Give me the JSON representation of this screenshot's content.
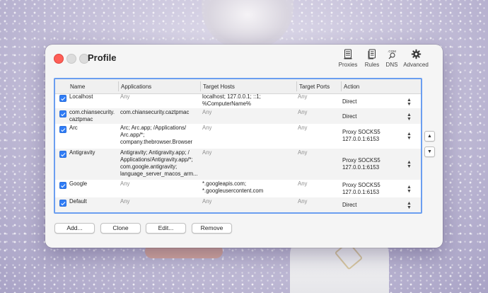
{
  "window": {
    "title": "Profile"
  },
  "toolbar": {
    "proxies": {
      "label": "Proxies",
      "icon": "server-icon"
    },
    "rules": {
      "label": "Rules",
      "icon": "document-list-icon"
    },
    "dns": {
      "label": "DNS",
      "icon": "dns-icon",
      "badge": ".COM"
    },
    "advanced": {
      "label": "Advanced",
      "icon": "gear-icon"
    }
  },
  "table": {
    "headers": {
      "name": "Name",
      "applications": "Applications",
      "target_hosts": "Target Hosts",
      "target_ports": "Target Ports",
      "action": "Action"
    },
    "rows": [
      {
        "enabled": true,
        "name": "Localhost",
        "applications": "Any",
        "target_hosts": "localhost; 127.0.0.1; ::1; %ComputerName%",
        "target_ports": "Any",
        "action": "Direct"
      },
      {
        "enabled": true,
        "name": "com.chiansecurity. caztpmac",
        "applications": "com.chiansecurity.caztpmac",
        "target_hosts": "Any",
        "target_ports": "Any",
        "action": "Direct"
      },
      {
        "enabled": true,
        "name": "Arc",
        "applications": "Arc; Arc.app; /Applications/ Arc.app/*; company.thebrowser.Browser",
        "target_hosts": "Any",
        "target_ports": "Any",
        "action": "Proxy SOCKS5 127.0.0.1:6153"
      },
      {
        "enabled": true,
        "name": "Antigravity",
        "applications": "Antigravity; Antigravity.app; / Applications/Antigravity.app/*; com.google.antigravity; language_server_macos_arm...",
        "target_hosts": "Any",
        "target_ports": "Any",
        "action": "Proxy SOCKS5 127.0.0.1:6153"
      },
      {
        "enabled": true,
        "name": "Google",
        "applications": "Any",
        "target_hosts": "*.googleapis.com; *.googleusercontent.com",
        "target_ports": "Any",
        "action": "Proxy SOCKS5 127.0.0.1:6153"
      },
      {
        "enabled": true,
        "name": "Default",
        "applications": "Any",
        "target_hosts": "Any",
        "target_ports": "Any",
        "action": "Direct"
      }
    ]
  },
  "buttons": {
    "add": "Add...",
    "clone": "Clone",
    "edit": "Edit...",
    "remove": "Remove"
  },
  "colors": {
    "accent": "#2f7cf6",
    "selection_border": "#6b9ef0",
    "close": "#fe5f57"
  }
}
